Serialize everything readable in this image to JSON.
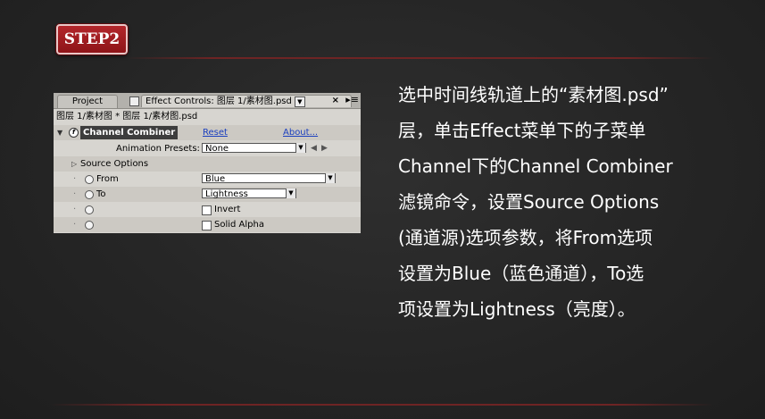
{
  "step_label": "STEP2",
  "panel": {
    "tab_project": "Project",
    "tab_effect_controls": "Effect Controls: 图层 1/素材图.psd",
    "tab_dropdown": "▼",
    "tab_close": "×",
    "tab_menu": "▸≡",
    "breadcrumb": "图层 1/素材图 * 图层 1/素材图.psd",
    "effect_name": "Channel Combiner",
    "reset_label": "Reset",
    "about_label": "About...",
    "presets_label": "Animation Presets:",
    "presets_value": "None",
    "source_options_label": "Source Options",
    "from_label": "From",
    "from_value": "Blue",
    "to_label": "To",
    "to_value": "Lightness",
    "invert_label": "Invert",
    "solid_alpha_label": "Solid Alpha"
  },
  "description_lines": [
    "选中时间线轨道上的“素材图.psd”",
    "层，单击Effect菜单下的子菜单",
    "Channel下的Channel Combiner",
    "滤镜命令，设置Source Options",
    "(通道源)选项参数，将From选项",
    "设置为Blue（蓝色通道），To选",
    "项设置为Lightness（亮度）。"
  ],
  "colors": {
    "badge_red": "#a01c21",
    "rule_red": "#6e2424",
    "text": "#ffffff",
    "link_blue": "#1a3fbf"
  }
}
